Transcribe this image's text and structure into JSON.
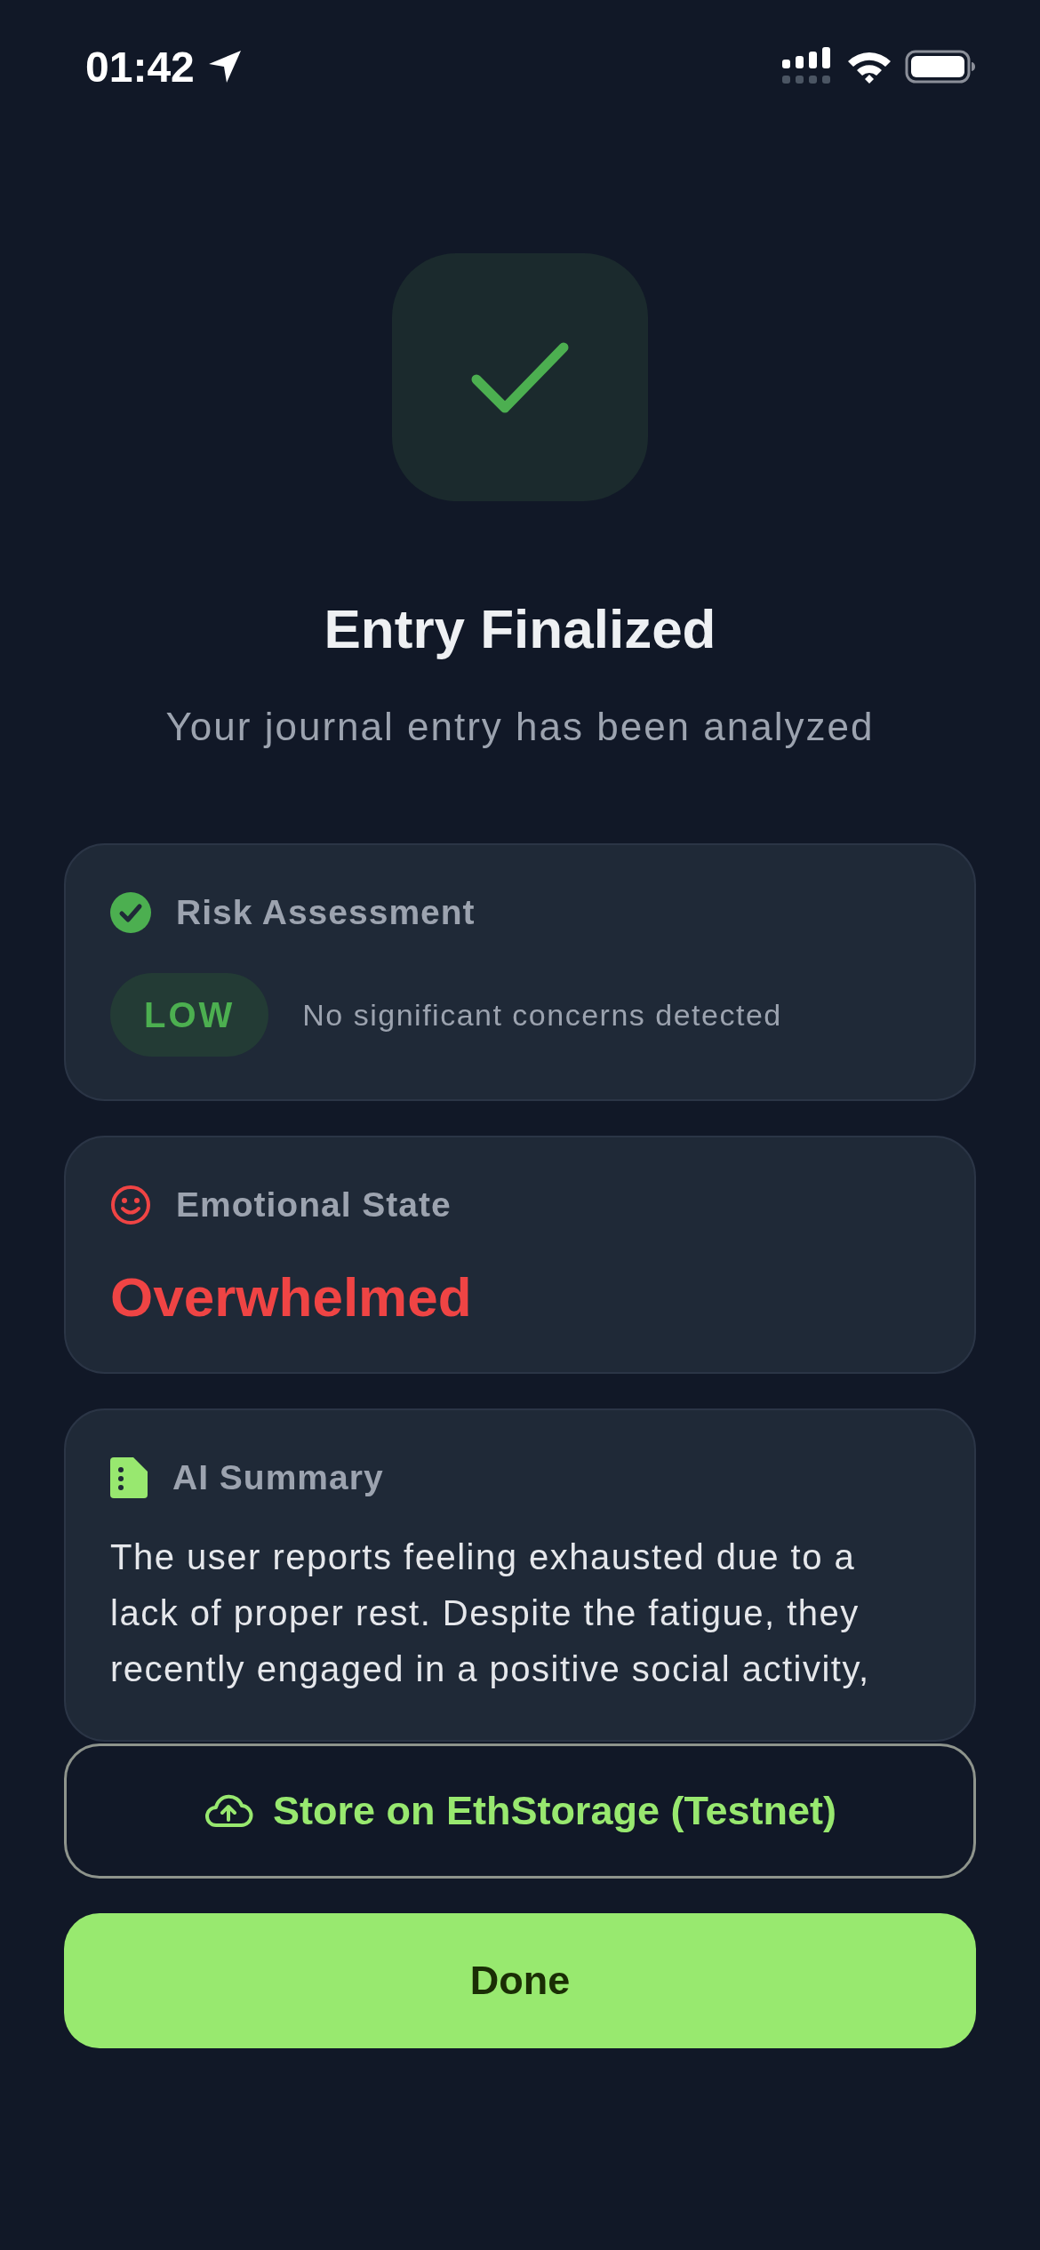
{
  "status_bar": {
    "time": "01:42"
  },
  "header": {
    "title": "Entry Finalized",
    "subtitle": "Your journal entry has been analyzed"
  },
  "cards": [
    {
      "kind": "risk",
      "title": "Risk Assessment",
      "badge": "LOW",
      "note": "No significant concerns detected"
    },
    {
      "kind": "emotion",
      "title": "Emotional State",
      "value": "Overwhelmed"
    },
    {
      "kind": "summary",
      "title": "AI Summary",
      "text": "The user reports feeling exhausted due to a lack of proper rest. Despite the fatigue, they recently engaged in a positive social activity,"
    }
  ],
  "buttons": [
    {
      "kind": "outline",
      "label": "Store on EthStorage (Testnet)"
    },
    {
      "kind": "primary",
      "label": "Done"
    }
  ]
}
